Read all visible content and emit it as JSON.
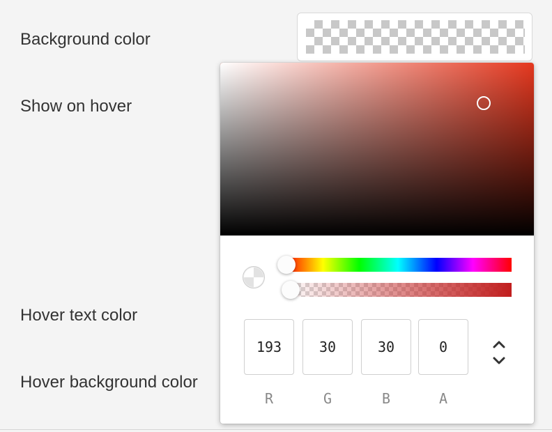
{
  "labels": {
    "background_color": "Background color",
    "show_on_hover": "Show on hover",
    "hover_text_color": "Hover text color",
    "hover_background_color": "Hover background color"
  },
  "picker": {
    "hue_color": "#e5381f",
    "current_color": "#c11e1e",
    "hue_level": 0,
    "alpha_level": 0,
    "fields": {
      "r": {
        "label": "R",
        "value": "193"
      },
      "g": {
        "label": "G",
        "value": "30"
      },
      "b": {
        "label": "B",
        "value": "30"
      },
      "a": {
        "label": "A",
        "value": "0"
      }
    },
    "toggle_icon": "chevron-up-down-icon"
  }
}
